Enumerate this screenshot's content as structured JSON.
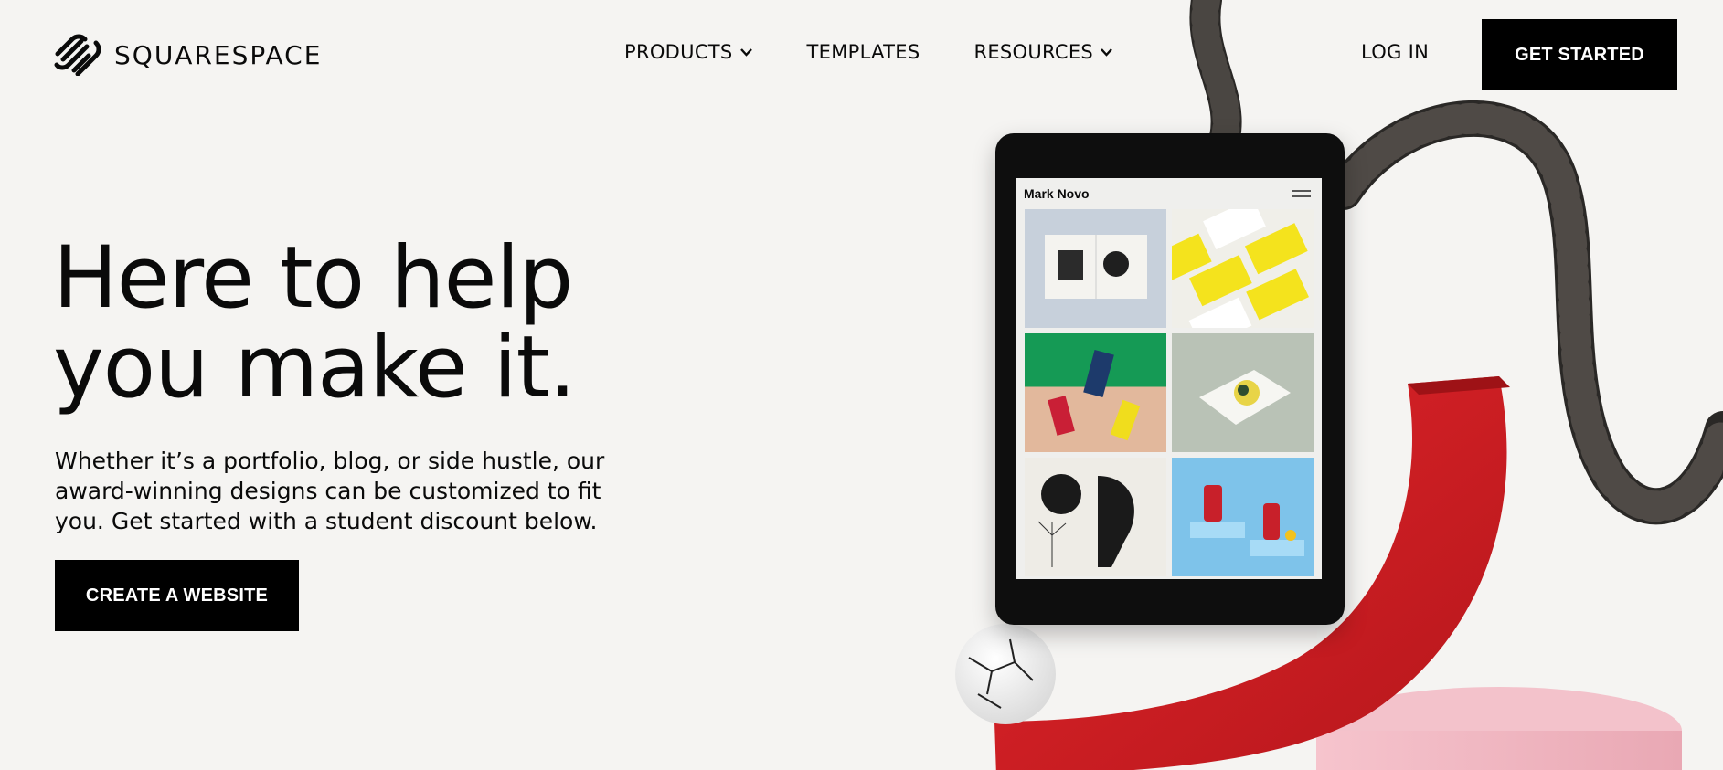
{
  "brand": {
    "name": "SQUARESPACE"
  },
  "nav": {
    "items": [
      {
        "label": "PRODUCTS",
        "has_dropdown": true
      },
      {
        "label": "TEMPLATES",
        "has_dropdown": false
      },
      {
        "label": "RESOURCES",
        "has_dropdown": true
      }
    ],
    "login_label": "LOG IN",
    "cta_label": "GET STARTED"
  },
  "hero": {
    "headline_line1": "Here to help",
    "headline_line2": "you make it.",
    "subcopy": "Whether it’s a portfolio, blog, or side hustle, our award-winning designs can be customized to fit you. Get started with a student discount below.",
    "cta_label": "CREATE A WEBSITE"
  },
  "tablet": {
    "site_title": "Mark Novo"
  },
  "colors": {
    "background": "#f5f4f2",
    "button": "#000000",
    "button_text": "#ffffff",
    "arc_red": "#d52126",
    "pink_block": "#f0b8c2",
    "rope": "#2a2826"
  }
}
